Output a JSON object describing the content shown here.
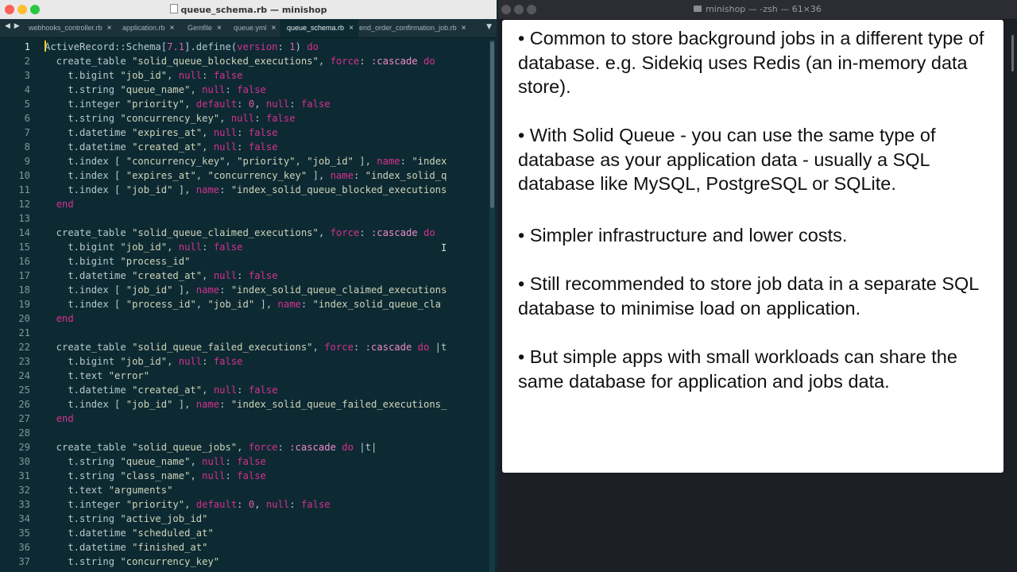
{
  "editor": {
    "window_title": "queue_schema.rb — minishop",
    "tabs": [
      {
        "label": "webhooks_controller.rb",
        "close": "×"
      },
      {
        "label": "application.rb",
        "close": "×"
      },
      {
        "label": "Gemfile",
        "close": "×"
      },
      {
        "label": "queue.yml",
        "close": "×"
      },
      {
        "label": "queue_schema.rb",
        "close": "×"
      },
      {
        "label": "end_order_confirmation_job.rb",
        "close": "×"
      }
    ],
    "active_tab": 4,
    "nav_arrows": "◀ ▶",
    "overflow": "▼",
    "cursor_line": 1,
    "code_lines": [
      "ActiveRecord::Schema[7.1].define(version: 1) do",
      "  create_table \"solid_queue_blocked_executions\", force: :cascade do",
      "    t.bigint \"job_id\", null: false",
      "    t.string \"queue_name\", null: false",
      "    t.integer \"priority\", default: 0, null: false",
      "    t.string \"concurrency_key\", null: false",
      "    t.datetime \"expires_at\", null: false",
      "    t.datetime \"created_at\", null: false",
      "    t.index [ \"concurrency_key\", \"priority\", \"job_id\" ], name: \"index",
      "    t.index [ \"expires_at\", \"concurrency_key\" ], name: \"index_solid_q",
      "    t.index [ \"job_id\" ], name: \"index_solid_queue_blocked_executions",
      "  end",
      "",
      "  create_table \"solid_queue_claimed_executions\", force: :cascade do",
      "    t.bigint \"job_id\", null: false",
      "    t.bigint \"process_id\"",
      "    t.datetime \"created_at\", null: false",
      "    t.index [ \"job_id\" ], name: \"index_solid_queue_claimed_executions",
      "    t.index [ \"process_id\", \"job_id\" ], name: \"index_solid_queue_cla",
      "  end",
      "",
      "  create_table \"solid_queue_failed_executions\", force: :cascade do |t",
      "    t.bigint \"job_id\", null: false",
      "    t.text \"error\"",
      "    t.datetime \"created_at\", null: false",
      "    t.index [ \"job_id\" ], name: \"index_solid_queue_failed_executions_",
      "  end",
      "",
      "  create_table \"solid_queue_jobs\", force: :cascade do |t|",
      "    t.string \"queue_name\", null: false",
      "    t.string \"class_name\", null: false",
      "    t.text \"arguments\"",
      "    t.integer \"priority\", default: 0, null: false",
      "    t.string \"active_job_id\"",
      "    t.datetime \"scheduled_at\"",
      "    t.datetime \"finished_at\"",
      "    t.string \"concurrency_key\""
    ],
    "line_numbers": [
      "1",
      "2",
      "3",
      "4",
      "5",
      "6",
      "7",
      "8",
      "9",
      "10",
      "11",
      "12",
      "13",
      "14",
      "15",
      "16",
      "17",
      "18",
      "19",
      "20",
      "21",
      "22",
      "23",
      "24",
      "25",
      "26",
      "27",
      "28",
      "29",
      "30",
      "31",
      "32",
      "33",
      "34",
      "35",
      "36",
      "37"
    ]
  },
  "terminal": {
    "window_title": "minishop — -zsh — 61×36"
  },
  "slide": {
    "bullets": [
      "• Common to store background jobs in a different type of database. e.g. Sidekiq uses Redis (an in-memory data store).",
      "• With Solid Queue - you can use the same type of database as your application data - usually a SQL database like MySQL, PostgreSQL or SQLite.",
      "• Simpler infrastructure and lower costs.",
      "• Still recommended to store job data in a separate SQL database to minimise load on application.",
      "• But simple apps with small workloads can share the same database for application and jobs data."
    ]
  },
  "colors": {
    "editor_bg": "#0d2a33",
    "keyword": "#d6308f",
    "string": "#cfd3b8",
    "symbol": "#f08ac8",
    "number": "#e05aa5"
  }
}
